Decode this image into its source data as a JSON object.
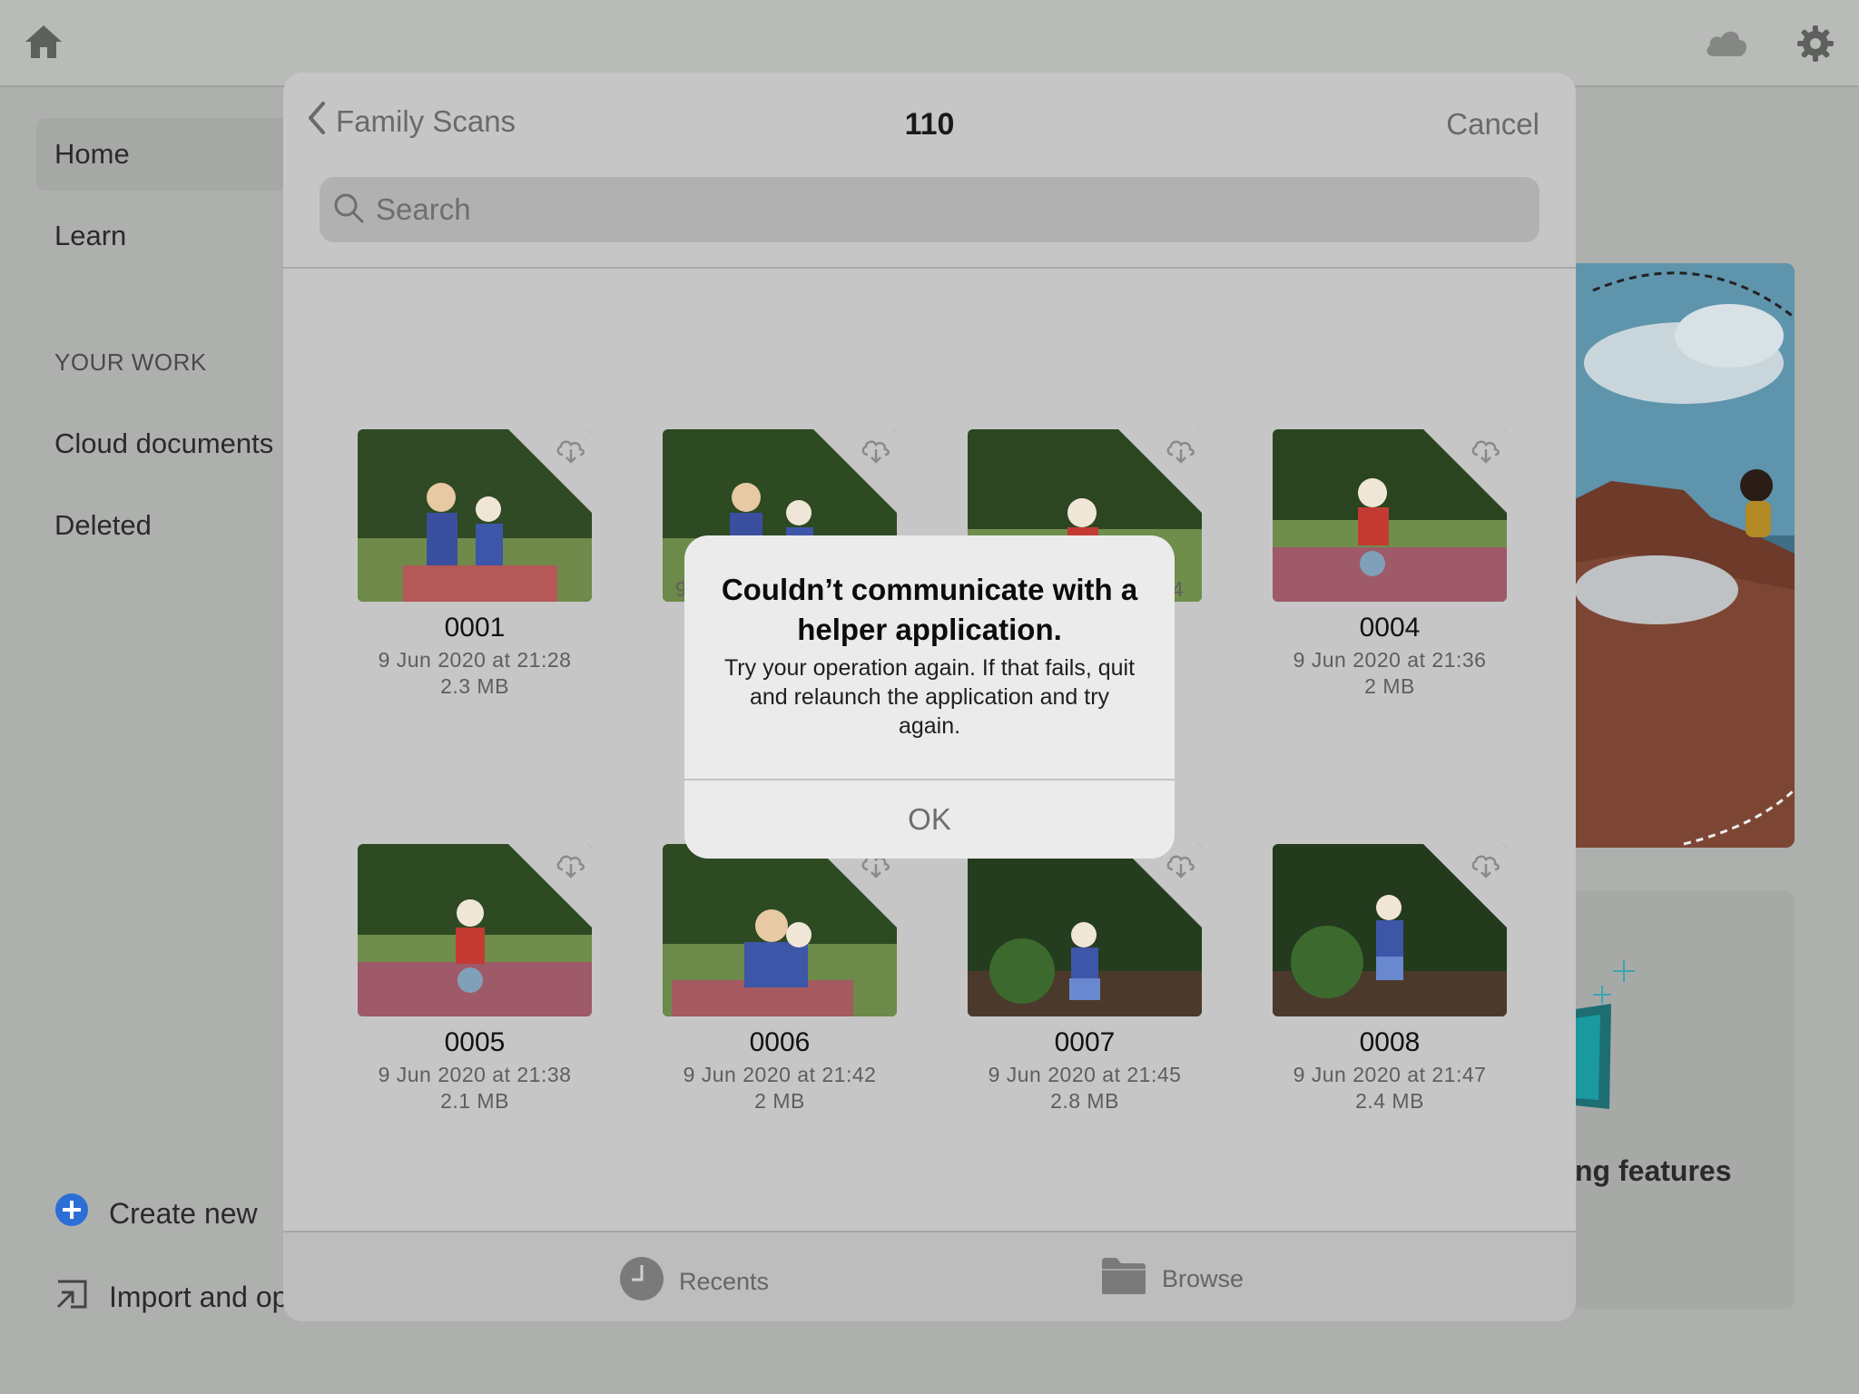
{
  "sidebar": {
    "items": [
      {
        "label": "Home"
      },
      {
        "label": "Learn"
      }
    ],
    "section_label": "YOUR WORK",
    "work_items": [
      {
        "label": "Cloud documents"
      },
      {
        "label": "Deleted"
      }
    ],
    "create_new_label": "Create new",
    "import_label": "Import and op"
  },
  "feature_card": {
    "text": "ng features"
  },
  "picker": {
    "back_label": "Family Scans",
    "title": "110",
    "cancel_label": "Cancel",
    "search_placeholder": "Search",
    "files": [
      {
        "name": "0001",
        "date": "9 Jun 2020 at 21:28",
        "size": "2.3 MB"
      },
      {
        "name": "",
        "date": "9",
        "size": ""
      },
      {
        "name": "",
        "date": "4",
        "size": ""
      },
      {
        "name": "0004",
        "date": "9 Jun 2020 at 21:36",
        "size": "2 MB"
      },
      {
        "name": "0005",
        "date": "9 Jun 2020 at 21:38",
        "size": "2.1 MB"
      },
      {
        "name": "0006",
        "date": "9 Jun 2020 at 21:42",
        "size": "2 MB"
      },
      {
        "name": "0007",
        "date": "9 Jun 2020 at 21:45",
        "size": "2.8 MB"
      },
      {
        "name": "0008",
        "date": "9 Jun 2020 at 21:47",
        "size": "2.4 MB"
      }
    ],
    "tabs": [
      {
        "label": "Recents"
      },
      {
        "label": "Browse"
      }
    ]
  },
  "alert": {
    "title": "Couldn’t communicate with a helper application.",
    "message": "Try your operation again. If that fails, quit and relaunch the application and try again.",
    "ok_label": "OK"
  },
  "colors": {
    "dim_overlay": "#aeb0ae",
    "modal_bg": "#c6c6c6",
    "alert_bg": "#ebebeb",
    "create_icon": "#2b6fd6"
  }
}
